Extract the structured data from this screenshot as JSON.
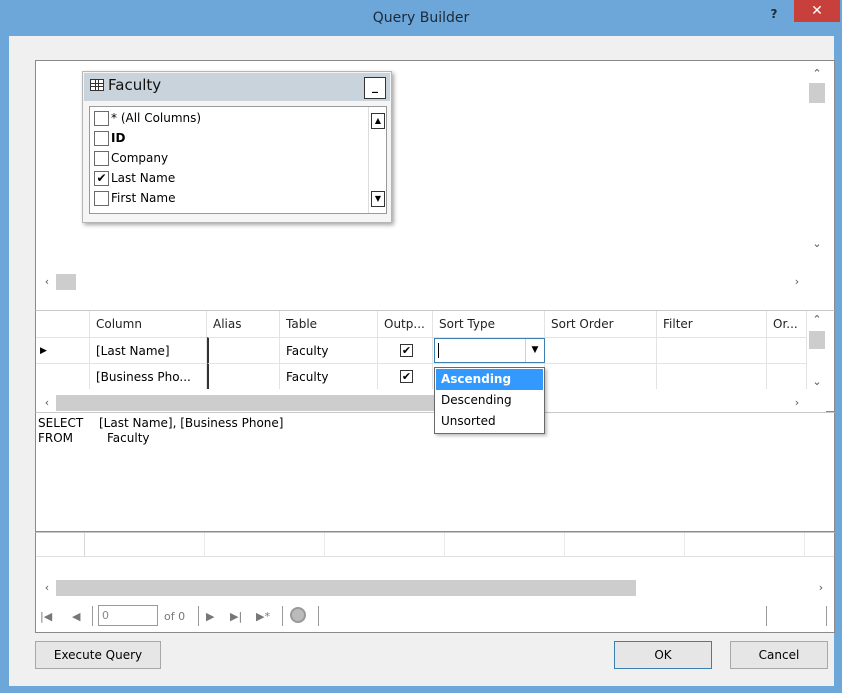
{
  "window": {
    "title": "Query Builder",
    "help_label": "?",
    "close_label": "✕"
  },
  "diagram": {
    "table_name": "Faculty",
    "minimize_label": "_",
    "columns": [
      {
        "label": "* (All Columns)",
        "checked": false,
        "bold": false
      },
      {
        "label": "ID",
        "checked": false,
        "bold": true
      },
      {
        "label": "Company",
        "checked": false,
        "bold": false
      },
      {
        "label": "Last Name",
        "checked": true,
        "bold": false
      },
      {
        "label": "First Name",
        "checked": false,
        "bold": false
      }
    ]
  },
  "grid": {
    "headers": [
      "Column",
      "Alias",
      "Table",
      "Outp...",
      "Sort Type",
      "Sort Order",
      "Filter",
      "Or..."
    ],
    "rows": [
      {
        "column": "[Last Name]",
        "alias": "",
        "table": "Faculty",
        "output": true,
        "current": true
      },
      {
        "column": "[Business Pho...",
        "alias": "",
        "table": "Faculty",
        "output": true,
        "current": false
      }
    ],
    "sort_type_value": "",
    "sort_options": [
      "Ascending",
      "Descending",
      "Unsorted"
    ],
    "selected_option": "Ascending"
  },
  "sql": {
    "select_kw": "SELECT",
    "select_val": "[Last Name], [Business Phone]",
    "from_kw": "FROM",
    "from_val": "Faculty"
  },
  "navigator": {
    "position": "0",
    "of_label": "of 0"
  },
  "buttons": {
    "execute": "Execute Query",
    "ok": "OK",
    "cancel": "Cancel"
  },
  "colors": {
    "titlebar": "#6da6d8",
    "close": "#c7403c",
    "selection": "#3399ff"
  }
}
